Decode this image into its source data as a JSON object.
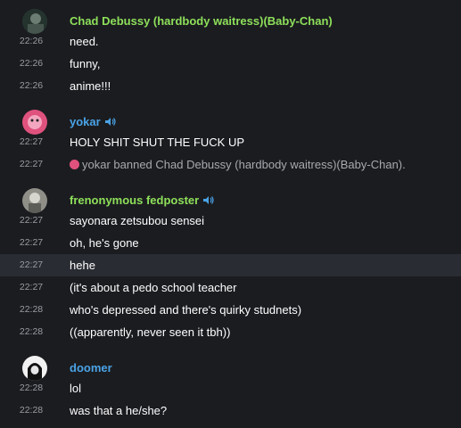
{
  "groups": [
    {
      "author": "Chad Debussy (hardbody waitress)(Baby-Chan)",
      "author_color": "#8ee05a",
      "avatar": "dark-figure-avatar",
      "messages": [
        {
          "time": "22:26",
          "text": "need."
        },
        {
          "time": "22:26",
          "text": "funny,"
        },
        {
          "time": "22:26",
          "text": "anime!!!"
        }
      ]
    },
    {
      "author": "yokar",
      "author_color": "#4aa3e6",
      "avatar": "pink-face-avatar",
      "messages": [
        {
          "time": "22:27",
          "text": "HOLY SHIT SHUT THE FUCK UP"
        }
      ],
      "system": {
        "time": "22:27",
        "text": "yokar banned Chad Debussy (hardbody waitress)(Baby-Chan)."
      }
    },
    {
      "author": "frenonymous fedposter",
      "author_color": "#8ee05a",
      "avatar": "grey-figure-avatar",
      "messages": [
        {
          "time": "22:27",
          "text": "sayonara zetsubou sensei"
        },
        {
          "time": "22:27",
          "text": "oh, he's gone"
        },
        {
          "time": "22:27",
          "text": "hehe"
        },
        {
          "time": "22:27",
          "text": "(it's about a pedo school teacher"
        },
        {
          "time": "22:28",
          "text": "who's depressed and there's quirky studnets)"
        },
        {
          "time": "22:28",
          "text": "((apparently, never seen it tbh))"
        }
      ]
    },
    {
      "author": "doomer",
      "author_color": "#4aa3e6",
      "avatar": "hooded-figure-avatar",
      "messages": [
        {
          "time": "22:28",
          "text": "lol"
        },
        {
          "time": "22:28",
          "text": "was that a he/she?"
        }
      ]
    }
  ]
}
